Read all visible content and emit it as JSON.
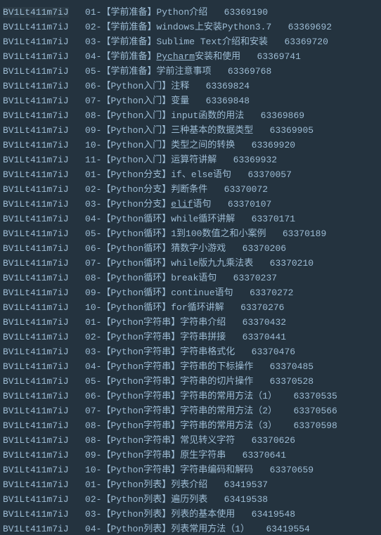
{
  "rows": [
    {
      "bvid": "BV1Lt411m7iJ",
      "index": "01",
      "category": "学前准备",
      "name": "Python介绍",
      "cid": "63369190",
      "underline_words": []
    },
    {
      "bvid": "BV1Lt411m7iJ",
      "index": "02",
      "category": "学前准备",
      "name": "windows上安装Python3.7",
      "cid": "63369692",
      "underline_words": []
    },
    {
      "bvid": "BV1Lt411m7iJ",
      "index": "03",
      "category": "学前准备",
      "name": "Sublime Text介绍和安装",
      "cid": "63369720",
      "underline_words": []
    },
    {
      "bvid": "BV1Lt411m7iJ",
      "index": "04",
      "category": "学前准备",
      "name": "Pycharm安装和使用",
      "cid": "63369741",
      "underline_words": [
        "Pycharm"
      ]
    },
    {
      "bvid": "BV1Lt411m7iJ",
      "index": "05",
      "category": "学前准备",
      "name": "学前注意事项",
      "cid": "63369768",
      "underline_words": []
    },
    {
      "bvid": "BV1Lt411m7iJ",
      "index": "06",
      "category": "Python入门",
      "name": "注释",
      "cid": "63369824",
      "underline_words": []
    },
    {
      "bvid": "BV1Lt411m7iJ",
      "index": "07",
      "category": "Python入门",
      "name": "变量",
      "cid": "63369848",
      "underline_words": []
    },
    {
      "bvid": "BV1Lt411m7iJ",
      "index": "08",
      "category": "Python入门",
      "name": "input函数的用法",
      "cid": "63369869",
      "underline_words": []
    },
    {
      "bvid": "BV1Lt411m7iJ",
      "index": "09",
      "category": "Python入门",
      "name": "三种基本的数据类型",
      "cid": "63369905",
      "underline_words": []
    },
    {
      "bvid": "BV1Lt411m7iJ",
      "index": "10",
      "category": "Python入门",
      "name": "类型之间的转换",
      "cid": "63369920",
      "underline_words": []
    },
    {
      "bvid": "BV1Lt411m7iJ",
      "index": "11",
      "category": "Python入门",
      "name": "运算符讲解",
      "cid": "63369932",
      "underline_words": []
    },
    {
      "bvid": "BV1Lt411m7iJ",
      "index": "01",
      "category": "Python分支",
      "name": "if、else语句",
      "cid": "63370057",
      "underline_words": []
    },
    {
      "bvid": "BV1Lt411m7iJ",
      "index": "02",
      "category": "Python分支",
      "name": "判断条件",
      "cid": "63370072",
      "underline_words": []
    },
    {
      "bvid": "BV1Lt411m7iJ",
      "index": "03",
      "category": "Python分支",
      "name": "elif语句",
      "cid": "63370107",
      "underline_words": [
        "elif"
      ]
    },
    {
      "bvid": "BV1Lt411m7iJ",
      "index": "04",
      "category": "Python循环",
      "name": "while循环讲解",
      "cid": "63370171",
      "underline_words": []
    },
    {
      "bvid": "BV1Lt411m7iJ",
      "index": "05",
      "category": "Python循环",
      "name": "1到100数值之和小案例",
      "cid": "63370189",
      "underline_words": []
    },
    {
      "bvid": "BV1Lt411m7iJ",
      "index": "06",
      "category": "Python循环",
      "name": "猜数字小游戏",
      "cid": "63370206",
      "underline_words": []
    },
    {
      "bvid": "BV1Lt411m7iJ",
      "index": "07",
      "category": "Python循环",
      "name": "while版九九乘法表",
      "cid": "63370210",
      "underline_words": []
    },
    {
      "bvid": "BV1Lt411m7iJ",
      "index": "08",
      "category": "Python循环",
      "name": "break语句",
      "cid": "63370237",
      "underline_words": []
    },
    {
      "bvid": "BV1Lt411m7iJ",
      "index": "09",
      "category": "Python循环",
      "name": "continue语句",
      "cid": "63370272",
      "underline_words": []
    },
    {
      "bvid": "BV1Lt411m7iJ",
      "index": "10",
      "category": "Python循环",
      "name": "for循环讲解",
      "cid": "63370276",
      "underline_words": []
    },
    {
      "bvid": "BV1Lt411m7iJ",
      "index": "01",
      "category": "Python字符串",
      "name": "字符串介绍",
      "cid": "63370432",
      "underline_words": []
    },
    {
      "bvid": "BV1Lt411m7iJ",
      "index": "02",
      "category": "Python字符串",
      "name": "字符串拼接",
      "cid": "63370441",
      "underline_words": []
    },
    {
      "bvid": "BV1Lt411m7iJ",
      "index": "03",
      "category": "Python字符串",
      "name": "字符串格式化",
      "cid": "63370476",
      "underline_words": []
    },
    {
      "bvid": "BV1Lt411m7iJ",
      "index": "04",
      "category": "Python字符串",
      "name": "字符串的下标操作",
      "cid": "63370485",
      "underline_words": []
    },
    {
      "bvid": "BV1Lt411m7iJ",
      "index": "05",
      "category": "Python字符串",
      "name": "字符串的切片操作",
      "cid": "63370528",
      "underline_words": []
    },
    {
      "bvid": "BV1Lt411m7iJ",
      "index": "06",
      "category": "Python字符串",
      "name": "字符串的常用方法（1）",
      "cid": "63370535",
      "underline_words": []
    },
    {
      "bvid": "BV1Lt411m7iJ",
      "index": "07",
      "category": "Python字符串",
      "name": "字符串的常用方法（2）",
      "cid": "63370566",
      "underline_words": []
    },
    {
      "bvid": "BV1Lt411m7iJ",
      "index": "08",
      "category": "Python字符串",
      "name": "字符串的常用方法（3）",
      "cid": "63370598",
      "underline_words": []
    },
    {
      "bvid": "BV1Lt411m7iJ",
      "index": "08",
      "category": "Python字符串",
      "name": "常见转义字符",
      "cid": "63370626",
      "underline_words": []
    },
    {
      "bvid": "BV1Lt411m7iJ",
      "index": "09",
      "category": "Python字符串",
      "name": "原生字符串",
      "cid": "63370641",
      "underline_words": []
    },
    {
      "bvid": "BV1Lt411m7iJ",
      "index": "10",
      "category": "Python字符串",
      "name": "字符串编码和解码",
      "cid": "63370659",
      "underline_words": []
    },
    {
      "bvid": "BV1Lt411m7iJ",
      "index": "01",
      "category": "Python列表",
      "name": "列表介绍",
      "cid": "63419537",
      "underline_words": []
    },
    {
      "bvid": "BV1Lt411m7iJ",
      "index": "02",
      "category": "Python列表",
      "name": "遍历列表",
      "cid": "63419538",
      "underline_words": []
    },
    {
      "bvid": "BV1Lt411m7iJ",
      "index": "03",
      "category": "Python列表",
      "name": "列表的基本使用",
      "cid": "63419548",
      "underline_words": []
    },
    {
      "bvid": "BV1Lt411m7iJ",
      "index": "04",
      "category": "Python列表",
      "name": "列表常用方法（1）",
      "cid": "63419554",
      "underline_words": []
    }
  ]
}
